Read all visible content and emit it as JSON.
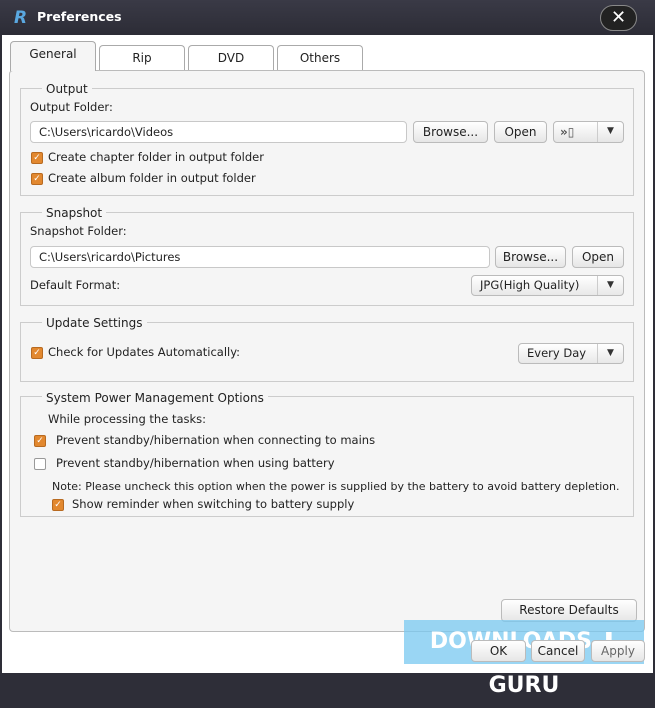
{
  "window": {
    "title": "Preferences",
    "close": "✕"
  },
  "tabs": [
    "General",
    "Rip",
    "DVD",
    "Others"
  ],
  "output": {
    "legend": "Output",
    "folder_label": "Output Folder:",
    "folder": "C:\\Users\\ricardo\\Videos",
    "browse": "Browse...",
    "open": "Open",
    "device_icon": "»▯",
    "chapter": "Create chapter folder in output folder",
    "album": "Create album folder in output folder"
  },
  "snapshot": {
    "legend": "Snapshot",
    "folder_label": "Snapshot Folder:",
    "folder": "C:\\Users\\ricardo\\Pictures",
    "browse": "Browse...",
    "open": "Open",
    "format_label": "Default Format:",
    "format": "JPG(High Quality)"
  },
  "update": {
    "legend": "Update Settings",
    "check": "Check for Updates Automatically:",
    "frequency": "Every Day"
  },
  "power": {
    "legend": "System Power Management Options",
    "intro": "While processing the tasks:",
    "mains": "Prevent standby/hibernation when connecting to mains",
    "battery": "Prevent standby/hibernation when using battery",
    "note": "Note: Please uncheck this option when the power is supplied by the battery to avoid battery depletion.",
    "reminder": "Show reminder when switching to battery supply"
  },
  "footer": {
    "restore": "Restore Defaults",
    "ok": "OK",
    "cancel": "Cancel",
    "apply": "Apply"
  },
  "watermark": "DOWNLOADS ⬇ GURU"
}
